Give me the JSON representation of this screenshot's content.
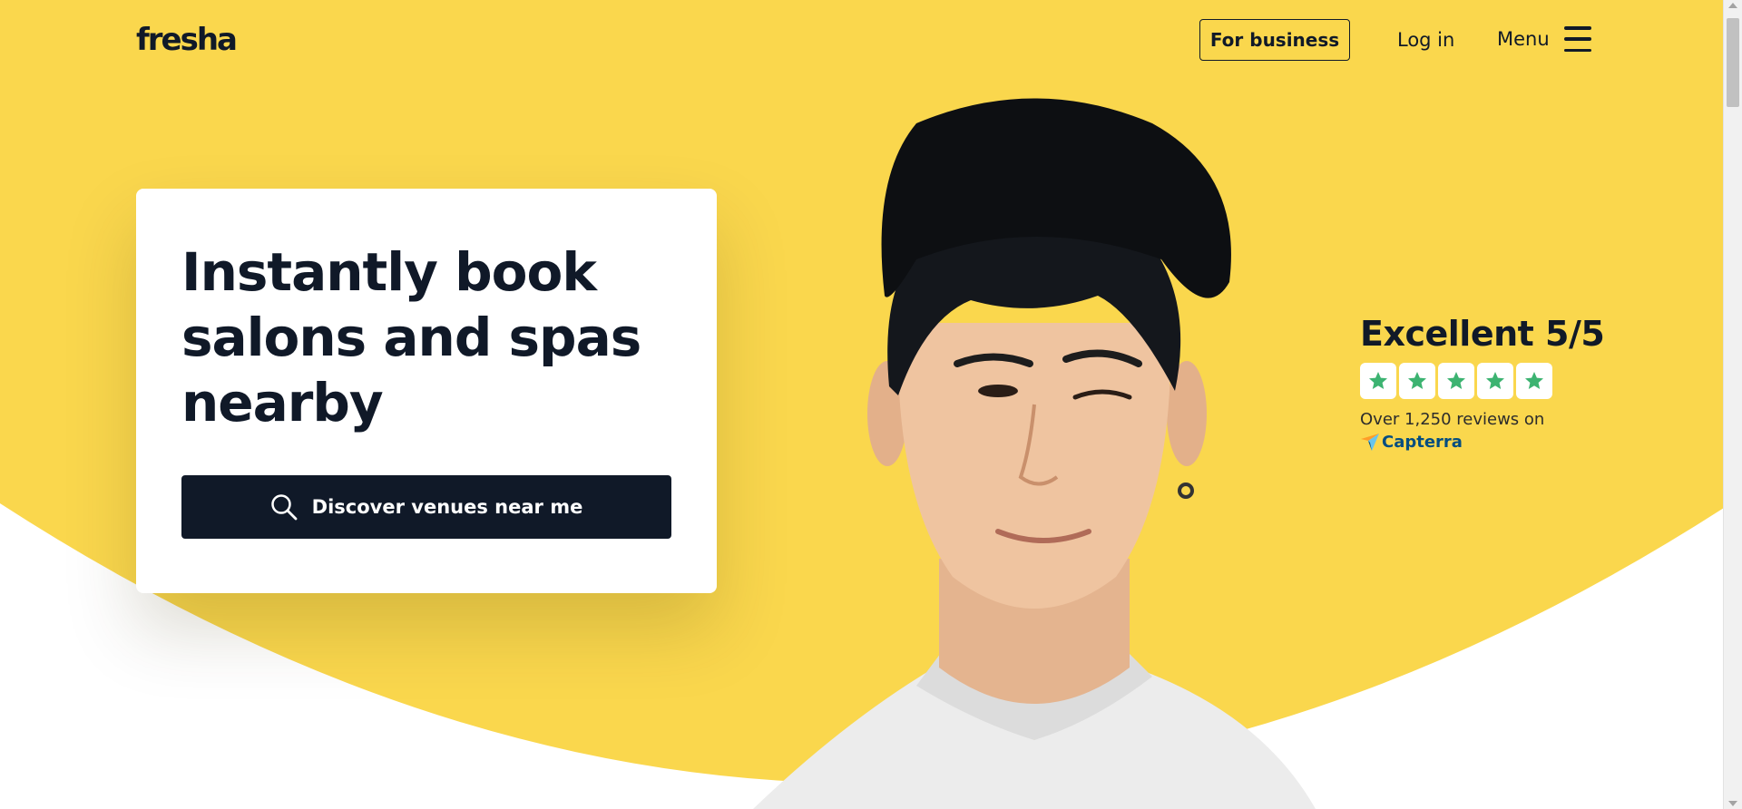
{
  "brand": {
    "logo_text": "fresha",
    "accent_color": "#FAD74D",
    "dark_color": "#101928"
  },
  "header": {
    "business_button": "For business",
    "login_link": "Log in",
    "menu_label": "Menu",
    "menu_icon": "hamburger-icon"
  },
  "hero": {
    "headline": "Instantly book salons and spas nearby",
    "cta_label": "Discover venues near me",
    "cta_icon": "search-icon"
  },
  "rating": {
    "title": "Excellent 5/5",
    "stars": 5,
    "star_color": "#3CB371",
    "reviews_text": "Over 1,250 reviews on",
    "platform": "Capterra",
    "platform_icon": "capterra-logo-icon"
  }
}
